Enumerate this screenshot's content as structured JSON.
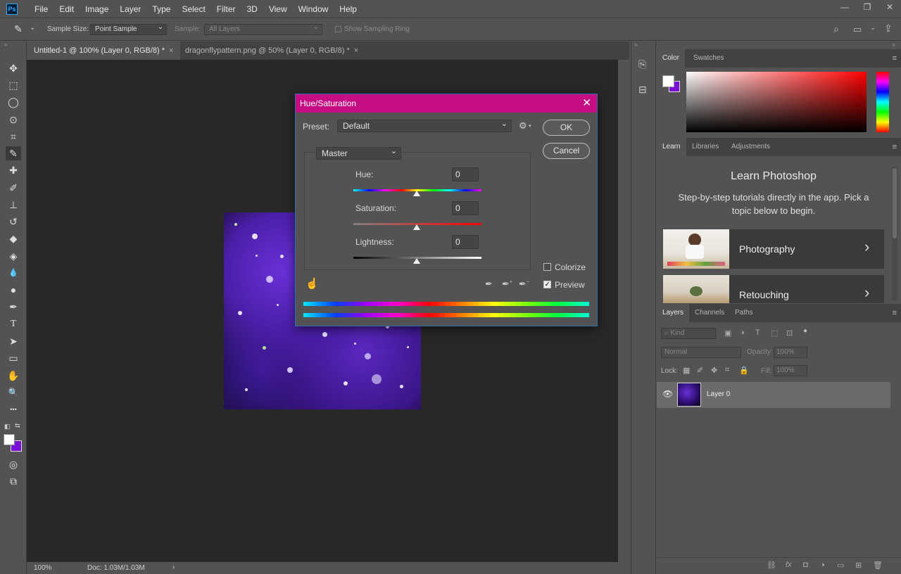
{
  "app": {
    "logo": "Ps"
  },
  "menu": [
    "File",
    "Edit",
    "Image",
    "Layer",
    "Type",
    "Select",
    "Filter",
    "3D",
    "View",
    "Window",
    "Help"
  ],
  "window_controls": {
    "minimize": "—",
    "restore": "❐",
    "close": "✕"
  },
  "options_bar": {
    "sample_size_label": "Sample Size:",
    "sample_size_value": "Point Sample",
    "sample_label": "Sample:",
    "sample_value": "All Layers",
    "sampling_ring_label": "Show Sampling Ring"
  },
  "tabs": [
    {
      "title": "Untitled-1 @ 100% (Layer 0, RGB/8) *",
      "close": "×"
    },
    {
      "title": "dragonflypattern.png @ 50% (Layer 0, RGB/8) *",
      "close": "×"
    }
  ],
  "tools": {
    "move": "✥",
    "marquee": "⬚",
    "lasso": "◯",
    "quick_select": "⊙",
    "crop": "⌗",
    "eyedropper": "✎",
    "healing": "✚",
    "brush": "✐",
    "stamp": "⊥",
    "history_brush": "↺",
    "eraser": "◆",
    "paint_bucket": "◈",
    "blur": "💧",
    "dodge": "●",
    "pen": "✒",
    "type": "T",
    "path_select": "➤",
    "rectangle": "▭",
    "hand": "✋",
    "zoom": "🔍",
    "more": "•••",
    "quick_mask": "◎",
    "screen_mode": "⧉"
  },
  "colors": {
    "foreground": "#ffffff",
    "background": "#7a10d8",
    "accent": "#31a8ff",
    "dialog_title": "#c50e83"
  },
  "status": {
    "zoom": "100%",
    "doc": "Doc: 1.03M/1.03M",
    "arrow": "›"
  },
  "dialog": {
    "title": "Hue/Saturation",
    "close": "✕",
    "preset_label": "Preset:",
    "preset_value": "Default",
    "settings_icon": "⚙",
    "channel_value": "Master",
    "hue_label": "Hue:",
    "hue_value": "0",
    "saturation_label": "Saturation:",
    "saturation_value": "0",
    "lightness_label": "Lightness:",
    "lightness_value": "0",
    "ok_label": "OK",
    "cancel_label": "Cancel",
    "colorize_label": "Colorize",
    "colorize_checked": "",
    "preview_label": "Preview",
    "preview_checked": "✓",
    "hand_icon": "☝",
    "eyedroppers": [
      "✒",
      "✒",
      "✒"
    ],
    "eyedropper_plus": "+",
    "eyedropper_minus": "−"
  },
  "right_panel": {
    "color_tabs": [
      "Color",
      "Swatches"
    ],
    "learn_tabs": [
      "Learn",
      "Libraries",
      "Adjustments"
    ],
    "learn_title": "Learn Photoshop",
    "learn_desc": "Step-by-step tutorials directly in the app. Pick a topic below to begin.",
    "learn_items": [
      {
        "label": "Photography",
        "chevron": "›"
      },
      {
        "label": "Retouching",
        "chevron": "›"
      }
    ],
    "layers_tabs": [
      "Layers",
      "Channels",
      "Paths"
    ],
    "kind_label": "Kind",
    "blend_mode": "Normal",
    "opacity_label": "Opacity:",
    "opacity_value": "100%",
    "lock_label": "Lock:",
    "fill_label": "Fill:",
    "fill_value": "100%",
    "layer_name": "Layer 0",
    "layer_visible_icon": "👁",
    "bottom_icons": [
      "⛓",
      "fx",
      "◘",
      "◑",
      "▭",
      "⊞",
      "🗑"
    ],
    "menu_icon": "≡"
  }
}
